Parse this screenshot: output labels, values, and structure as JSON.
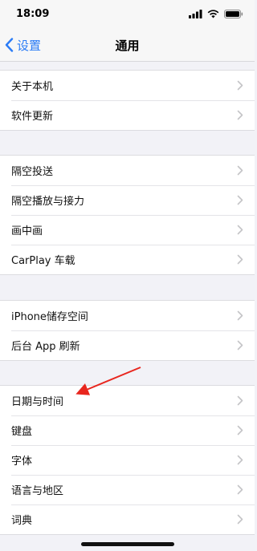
{
  "status_bar": {
    "time": "18:09",
    "icons": [
      "signal-icon",
      "wifi-icon",
      "battery-icon"
    ]
  },
  "nav": {
    "back_label": "设置",
    "title": "通用",
    "accent_color": "#2b7cf6"
  },
  "groups": [
    {
      "items": [
        {
          "label": "关于本机"
        },
        {
          "label": "软件更新"
        }
      ]
    },
    {
      "items": [
        {
          "label": "隔空投送"
        },
        {
          "label": "隔空播放与接力"
        },
        {
          "label": "画中画"
        },
        {
          "label": "CarPlay 车载"
        }
      ]
    },
    {
      "items": [
        {
          "label": "iPhone储存空间"
        },
        {
          "label": "后台 App 刷新"
        }
      ]
    },
    {
      "items": [
        {
          "label": "日期与时间"
        },
        {
          "label": "键盘"
        },
        {
          "label": "字体"
        },
        {
          "label": "语言与地区"
        },
        {
          "label": "词典"
        }
      ]
    }
  ],
  "annotation": {
    "arrow_color": "#e8261e",
    "points_to": "日期与时间"
  }
}
